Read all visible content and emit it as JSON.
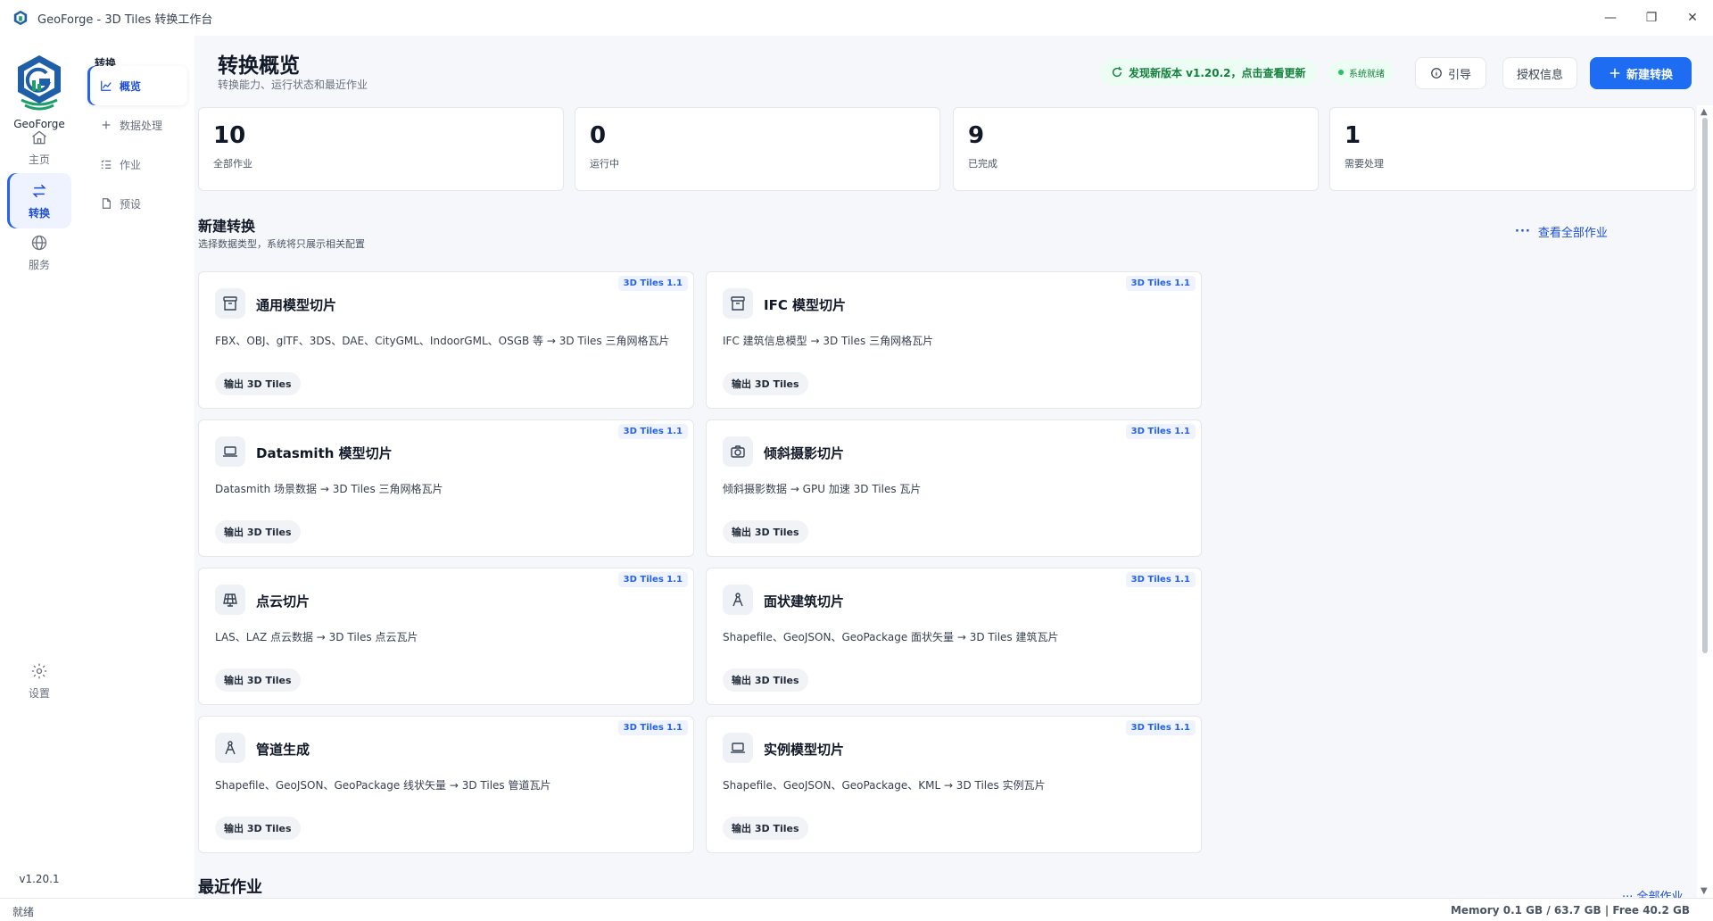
{
  "window": {
    "title": "GeoForge - 3D Tiles 转换工作台",
    "minimize": "—",
    "maximize": "❐",
    "close": "✕"
  },
  "brand": {
    "name": "GeoForge"
  },
  "rail": {
    "items": [
      {
        "label": "主页",
        "icon": "home-icon"
      },
      {
        "label": "转换",
        "icon": "swap-icon",
        "active": true
      },
      {
        "label": "服务",
        "icon": "globe-icon"
      }
    ],
    "settings": "设置",
    "version": "v1.20.1"
  },
  "subnav": {
    "title": "转换",
    "items": [
      {
        "label": "概览",
        "icon": "chart-icon",
        "active": true
      },
      {
        "label": "数据处理",
        "icon": "plus-icon"
      },
      {
        "label": "作业",
        "icon": "list-icon"
      },
      {
        "label": "预设",
        "icon": "file-icon"
      }
    ]
  },
  "header": {
    "title": "转换概览",
    "subtitle": "转换能力、运行状态和最近作业",
    "update_text": "发现新版本 v1.20.2，点击查看更新",
    "status_text": "系统就绪",
    "guide_label": "引导",
    "license_label": "授权信息",
    "new_label": "新建转换"
  },
  "stats": [
    {
      "value": "10",
      "label": "全部作业"
    },
    {
      "value": "0",
      "label": "运行中"
    },
    {
      "value": "9",
      "label": "已完成"
    },
    {
      "value": "1",
      "label": "需要处理"
    }
  ],
  "new_section": {
    "title": "新建转换",
    "subtitle": "选择数据类型，系统将只展示相关配置",
    "view_all": "查看全部作业"
  },
  "cards": [
    {
      "name": "通用模型切片",
      "desc": "FBX、OBJ、glTF、3DS、DAE、CityGML、IndoorGML、OSGB 等 → 3D Tiles 三角网格瓦片",
      "tag": "3D Tiles 1.1",
      "output": "输出 3D Tiles",
      "icon": "archive-icon"
    },
    {
      "name": "IFC 模型切片",
      "desc": "IFC 建筑信息模型 → 3D Tiles 三角网格瓦片",
      "tag": "3D Tiles 1.1",
      "output": "输出 3D Tiles",
      "icon": "archive-icon"
    },
    {
      "name": "Datasmith 模型切片",
      "desc": "Datasmith 场景数据 → 3D Tiles 三角网格瓦片",
      "tag": "3D Tiles 1.1",
      "output": "输出 3D Tiles",
      "icon": "laptop-icon"
    },
    {
      "name": "倾斜摄影切片",
      "desc": "倾斜摄影数据 → GPU 加速 3D Tiles 瓦片",
      "tag": "3D Tiles 1.1",
      "output": "输出 3D Tiles",
      "icon": "camera-icon"
    },
    {
      "name": "点云切片",
      "desc": "LAS、LAZ 点云数据 → 3D Tiles 点云瓦片",
      "tag": "3D Tiles 1.1",
      "output": "输出 3D Tiles",
      "icon": "solar-panel-icon"
    },
    {
      "name": "面状建筑切片",
      "desc": "Shapefile、GeoJSON、GeoPackage 面状矢量 → 3D Tiles 建筑瓦片",
      "tag": "3D Tiles 1.1",
      "output": "输出 3D Tiles",
      "icon": "compass-icon"
    },
    {
      "name": "管道生成",
      "desc": "Shapefile、GeoJSON、GeoPackage 线状矢量 → 3D Tiles 管道瓦片",
      "tag": "3D Tiles 1.1",
      "output": "输出 3D Tiles",
      "icon": "compass-icon"
    },
    {
      "name": "实例模型切片",
      "desc": "Shapefile、GeoJSON、GeoPackage、KML → 3D Tiles 实例瓦片",
      "tag": "3D Tiles 1.1",
      "output": "输出 3D Tiles",
      "icon": "laptop-icon"
    }
  ],
  "recent": {
    "title": "最近作业",
    "view_all": "··· 全部作业"
  },
  "statusbar": {
    "left": "就绪",
    "right": "Memory  0.1 GB / 63.7 GB  |  Free 40.2 GB"
  }
}
